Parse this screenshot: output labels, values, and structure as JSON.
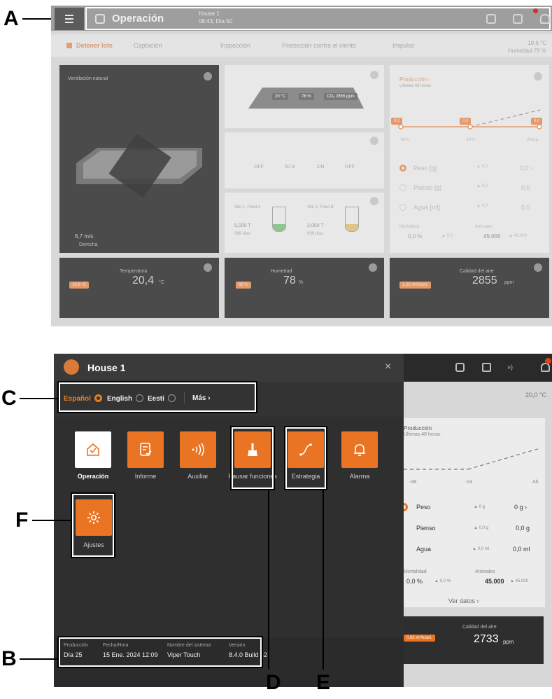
{
  "callouts": {
    "a": "A",
    "b": "B",
    "c": "C",
    "d": "D",
    "e": "E",
    "f": "F"
  },
  "top": {
    "title": "Operación",
    "house": "House 1",
    "subtitle": "08:43, Día 50",
    "tabs": [
      {
        "label": "Detener lote"
      },
      {
        "label": "Captación"
      },
      {
        "label": "Inspección"
      },
      {
        "label": "Protección contra el viento"
      },
      {
        "label": "Impulso"
      }
    ],
    "temp": "19,6 °C",
    "humidity": "Humedad 79 %",
    "ventilation": {
      "title": "Ventilación natural",
      "wind": "6,7 m/s",
      "wind_dir": "Derecha"
    },
    "house_card": {
      "temp": "20 °C",
      "humidity": "78 %",
      "co2": "CO₂ 2855 ppm"
    },
    "status_card": {
      "items": [
        "OFF",
        "50 lx",
        "ON",
        "OFF"
      ]
    },
    "silos": {
      "silo1_title": "Silo 1, Feed A",
      "silo1_amount": "5,000 T",
      "silo1_days": "999 días",
      "silo2_title": "Silo 2, Feed B",
      "silo2_amount": "3,000 T",
      "silo2_days": "999 días"
    },
    "production": {
      "title": "Producción",
      "subtitle": "Últimas 48 horas",
      "pill_values": [
        "0,0",
        "0,0",
        "0,0"
      ],
      "axis": [
        "-48 h",
        "-24 h",
        "Ahora"
      ],
      "rows": [
        {
          "name": "Peso [g]",
          "delta": "▲ 0,0",
          "value": "0,0 ›"
        },
        {
          "name": "Pienso [g]",
          "delta": "▲ 0,0",
          "value": "0,0"
        },
        {
          "name": "Agua [ml]",
          "delta": "▲ 0,0",
          "value": "0,0"
        }
      ],
      "mortality_label": "Mortalidad",
      "mortality": "0,0 %",
      "mortality_delta": "▲ 0,0",
      "animals_label": "Animales",
      "animals": "45.000",
      "animals_delta": "▲ 45.000"
    },
    "bottom_cards": [
      {
        "title": "Temperatura",
        "pill": "19,6 °C",
        "value": "20,4",
        "unit": "°C"
      },
      {
        "title": "Humedad",
        "pill": "85 %",
        "value": "78",
        "unit": "%"
      },
      {
        "title": "Calidad del aire",
        "pill": "1,25 m³/h/ani.",
        "value": "2855",
        "unit": "ppm"
      }
    ]
  },
  "menu": {
    "title": "House 1",
    "close": "×",
    "languages": [
      {
        "label": "Español",
        "active": true
      },
      {
        "label": "English",
        "active": false
      },
      {
        "label": "Eesti",
        "active": false
      }
    ],
    "more": "Más ›",
    "tiles": [
      {
        "label": "Operación",
        "icon": "home-check-icon"
      },
      {
        "label": "Informe",
        "icon": "report-icon"
      },
      {
        "label": "Auxiliar",
        "icon": "signal-icon"
      },
      {
        "label": "Pausar funciones",
        "icon": "broom-icon"
      },
      {
        "label": "Estrategia",
        "icon": "strategy-curve-icon"
      },
      {
        "label": "Alarma",
        "icon": "bell-icon"
      },
      {
        "label": "Ajustes",
        "icon": "gear-icon"
      }
    ],
    "footer": {
      "production_label": "Producción",
      "production": "Día 25",
      "date_label": "Fecha/Hora",
      "date": "15 Ene. 2024 12:09",
      "system_label": "Nombre del sistema",
      "system": "Viper Touch",
      "version_label": "Versión",
      "version": "8.4.0 Build 42"
    }
  },
  "underlay": {
    "temp": "20,0 °C",
    "production": "Producción",
    "subtitle": "Últimas 48 horas",
    "axis": [
      "-48",
      "-24",
      "Ah"
    ],
    "rows": [
      {
        "name": "Peso",
        "delta": "▲ 0 g",
        "value": "0 g ›"
      },
      {
        "name": "Pienso",
        "delta": "▲ 0,0 g",
        "value": "0,0 g"
      },
      {
        "name": "Agua",
        "delta": "▲ 0,0 ml",
        "value": "0,0 ml"
      }
    ],
    "mortality_label": "Mortalidad",
    "mortality": "0,0 %",
    "mortality_delta": "▲ 0,0 %",
    "animals_label": "Animales",
    "animals": "45.000",
    "animals_delta": "▲ 45.000",
    "ver_datos": "Ver datos ›",
    "air_title": "Calidad del aire",
    "air_pill": "0,65 m³/h/ani.",
    "air_value": "2733",
    "air_unit": "ppm"
  },
  "colors": {
    "accent": "#e97424",
    "accent_muted": "#e39d71",
    "panel": "#2f2f2f"
  }
}
